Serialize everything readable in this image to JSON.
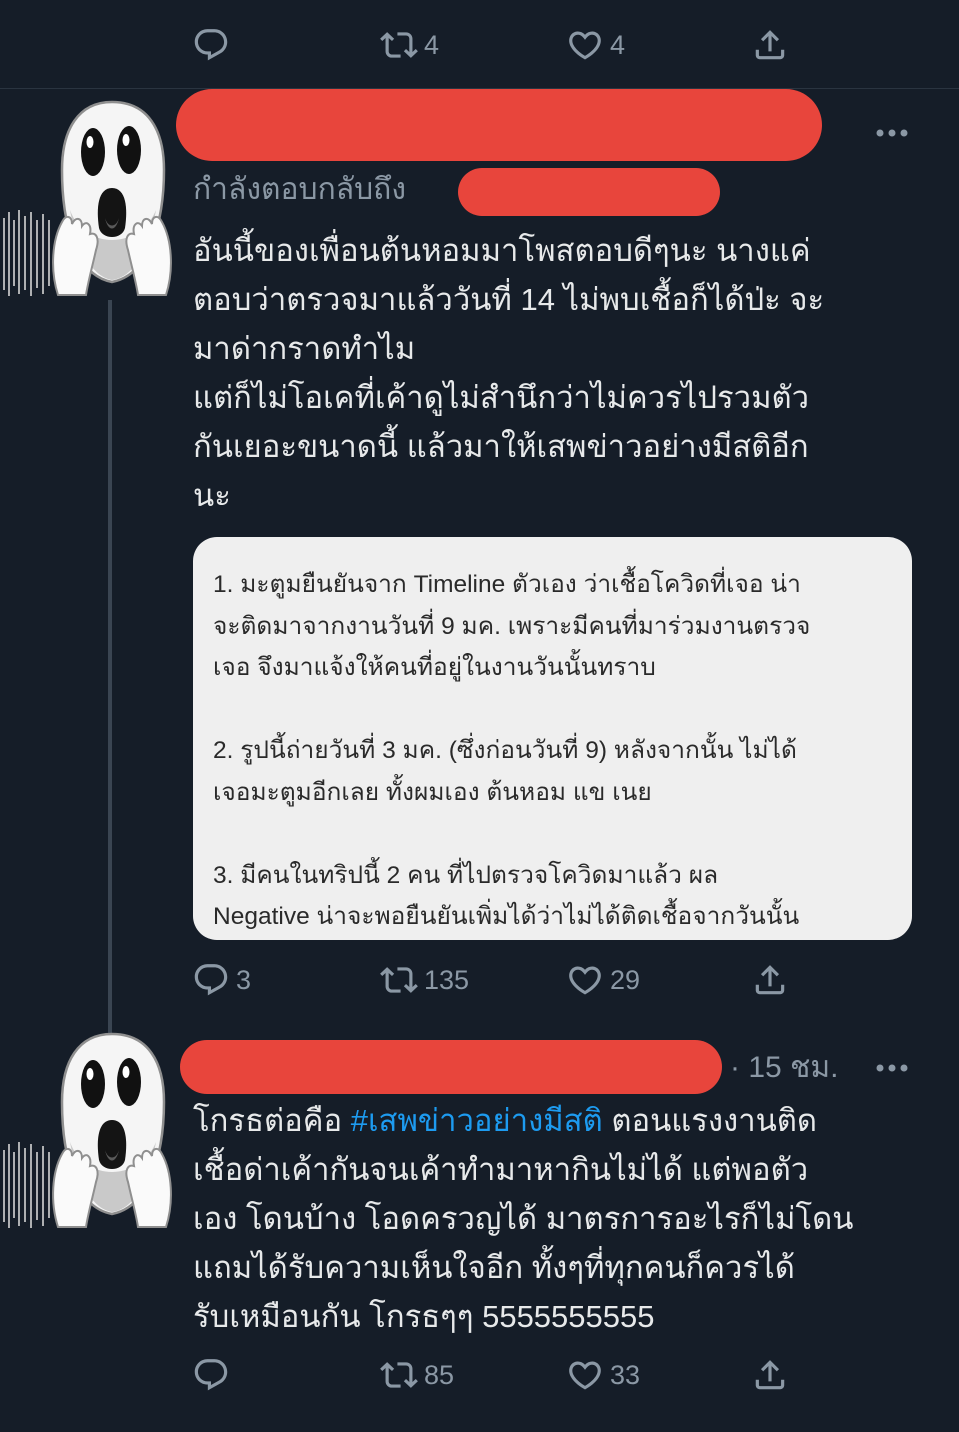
{
  "colors": {
    "background": "#151d28",
    "text": "#e7e9ea",
    "muted": "#8b98a5",
    "hashtag": "#1d9bf0",
    "redaction": "#e8453c",
    "divider": "#2a3440",
    "thread_line": "#3a4552",
    "media_background": "#efefef",
    "media_text": "#2a2a2a"
  },
  "icons": {
    "reply": "reply-icon",
    "retweet": "retweet-icon",
    "like": "like-icon",
    "share": "share-icon",
    "more": "more-icon",
    "avatar": "screaming-face-sticker"
  },
  "previous_tweet": {
    "actions": {
      "retweets": "4",
      "likes": "4"
    }
  },
  "tweets": [
    {
      "replying_to_label": "กำลังตอบกลับถึง",
      "text_lines": [
        "อันนี้ของเพื่อนต้นหอมมาโพสตอบดีๆนะ นางแค่",
        "ตอบว่าตรวจมาแล้ววันที่ 14 ไม่พบเชื้อก็ได้ป่ะ จะ",
        "มาด่ากราดทำไม",
        "แต่ก็ไม่โอเคที่เค้าดูไม่สำนึกว่าไม่ควรไปรวมตัว",
        "กันเยอะขนาดนี้ แล้วมาให้เสพข่าวอย่างมีสติอีก",
        "นะ"
      ],
      "media_text_paragraphs": [
        [
          "1. มะตูมยืนยันจาก Timeline ตัวเอง ว่าเชื้อโควิดที่เจอ น่า",
          "จะติดมาจากงานวันที่ 9 มค. เพราะมีคนที่มาร่วมงานตรวจ",
          "เจอ จึงมาแจ้งให้คนที่อยู่ในงานวันนั้นทราบ"
        ],
        [
          "2. รูปนี้ถ่ายวันที่ 3 มค. (ซึ่งก่อนวันที่ 9) หลังจากนั้น ไม่ได้",
          "เจอมะตูมอีกเลย ทั้งผมเอง ต้นหอม แข เนย"
        ],
        [
          "3. มีคนในทริปนี้ 2 คน ที่ไปตรวจโควิดมาแล้ว ผล",
          "Negative น่าจะพอยืนยันเพิ่มได้ว่าไม่ได้ติดเชื้อจากวันนั้น"
        ]
      ],
      "actions": {
        "replies": "3",
        "retweets": "135",
        "likes": "29"
      }
    },
    {
      "timestamp": "· 15 ชม.",
      "first_line": {
        "before": "โกรธต่อคือ ",
        "hashtag": "#เสพข่าวอย่างมีสติ",
        "after": " ตอนแรงงานติด"
      },
      "text_lines": [
        "เชื้อด่าเค้ากันจนเค้าทำมาหากินไม่ได้ แต่พอตัว",
        "เอง โดนบ้าง โอดครวญได้ มาตรการอะไรก็ไม่โดน",
        "แถมได้รับความเห็นใจอีก ทั้งๆที่ทุกคนก็ควรได้",
        "รับเหมือนกัน โกรธๆๆ 5555555555"
      ],
      "actions": {
        "retweets": "85",
        "likes": "33"
      }
    }
  ]
}
